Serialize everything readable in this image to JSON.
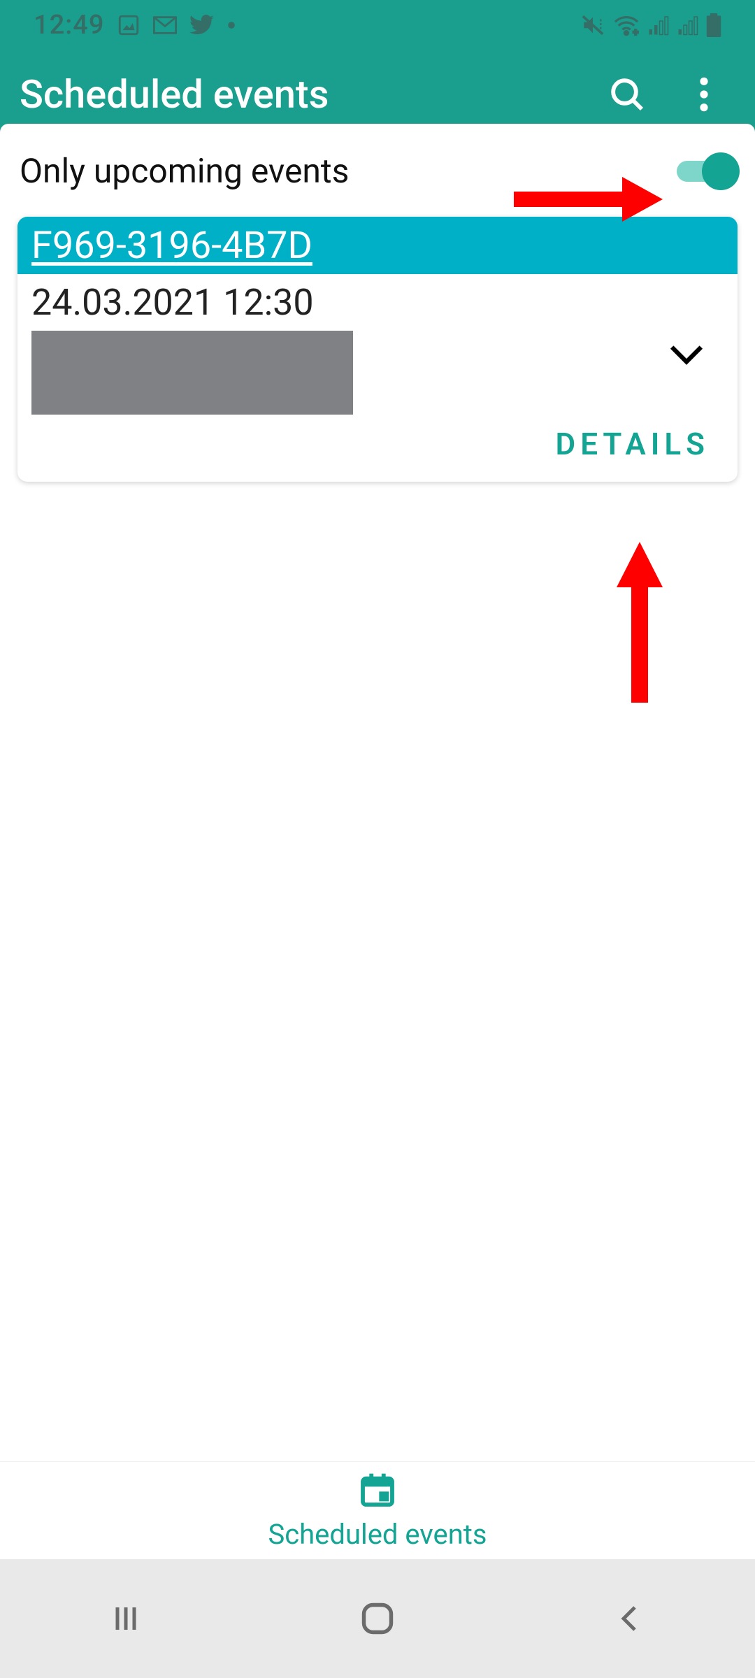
{
  "status": {
    "time": "12:49"
  },
  "appbar": {
    "title": "Scheduled events"
  },
  "filter": {
    "label": "Only upcoming events",
    "toggle_on": true
  },
  "card": {
    "id": "F969-3196-4B7D",
    "datetime": "24.03.2021  12:30",
    "details_label": "DETAILS"
  },
  "bottomnav": {
    "label": "Scheduled events"
  },
  "colors": {
    "primary": "#1a9e8d",
    "accent": "#13a494",
    "card_header": "#00b0c7",
    "annotation": "#ff0000"
  }
}
